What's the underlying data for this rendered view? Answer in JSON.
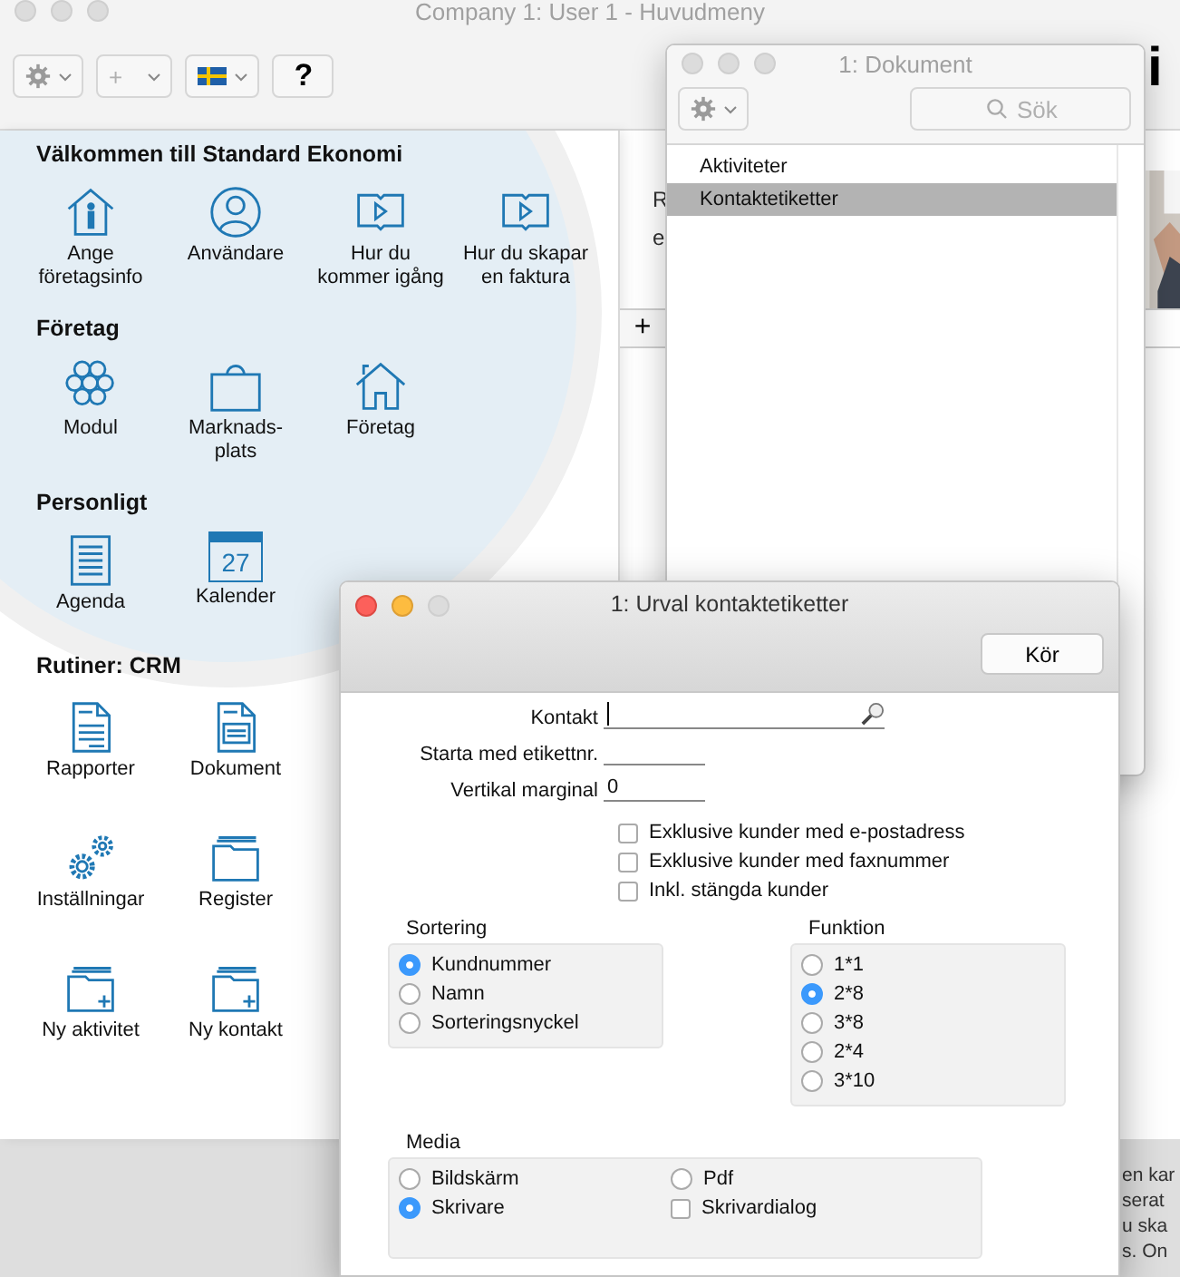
{
  "main_window": {
    "title": "Company 1: User 1 - Huvudmeny",
    "toolbar": {
      "add_label": "+",
      "help_label": "?"
    },
    "logo_fragment": "i",
    "sections": [
      {
        "title": "Välkommen till Standard Ekonomi",
        "items": [
          {
            "label": "Ange\nföretagsinfo",
            "kind": "info"
          },
          {
            "label": "Användare",
            "kind": "user"
          },
          {
            "label": "Hur du\nkommer igång",
            "kind": "guide"
          },
          {
            "label": "Hur du skapar\nen faktura",
            "kind": "guide"
          }
        ]
      },
      {
        "title": "Företag",
        "items": [
          {
            "label": "Modul",
            "kind": "modules"
          },
          {
            "label": "Marknads-\nplats",
            "kind": "bag"
          },
          {
            "label": "Företag",
            "kind": "house"
          }
        ]
      },
      {
        "title": "Personligt",
        "items": [
          {
            "label": "Agenda",
            "kind": "agenda"
          },
          {
            "label": "Kalender",
            "kind": "calendar",
            "day": "27"
          }
        ]
      },
      {
        "title": "Rutiner: CRM",
        "items": [
          {
            "label": "Rapporter",
            "kind": "report"
          },
          {
            "label": "Dokument",
            "kind": "document"
          },
          {
            "label": "Inställningar",
            "kind": "gears"
          },
          {
            "label": "Register",
            "kind": "folder"
          },
          {
            "label": "Ny aktivitet",
            "kind": "folder-add"
          },
          {
            "label": "Ny kontakt",
            "kind": "folder-add"
          }
        ]
      }
    ],
    "right_pane": {
      "text_fragments": [
        "R",
        "e"
      ],
      "add_label": "+"
    },
    "background_text": [
      "en kar",
      "serat",
      "u ska",
      "s. On"
    ]
  },
  "document_window": {
    "title": "1: Dokument",
    "search": {
      "placeholder": "Sök"
    },
    "items": [
      {
        "label": "Aktiviteter",
        "selected": false
      },
      {
        "label": "Kontaktetiketter",
        "selected": true
      }
    ]
  },
  "dialog": {
    "title": "1: Urval kontaktetiketter",
    "run_button": "Kör",
    "fields": [
      {
        "label": "Kontakt",
        "kind": "lookup"
      },
      {
        "label": "Starta med etikettnr.",
        "kind": "short"
      },
      {
        "label": "Vertikal marginal",
        "value": "0",
        "kind": "short"
      }
    ],
    "checkboxes": [
      {
        "label": "Exklusive kunder med e-postadress",
        "checked": false
      },
      {
        "label": "Exklusive kunder med faxnummer",
        "checked": false
      },
      {
        "label": "Inkl. stängda kunder",
        "checked": false
      }
    ],
    "sorting": {
      "title": "Sortering",
      "options": [
        {
          "label": "Kundnummer",
          "selected": true
        },
        {
          "label": "Namn",
          "selected": false
        },
        {
          "label": "Sorteringsnyckel",
          "selected": false
        }
      ]
    },
    "function": {
      "title": "Funktion",
      "options": [
        {
          "label": "1*1",
          "selected": false
        },
        {
          "label": "2*8",
          "selected": true
        },
        {
          "label": "3*8",
          "selected": false
        },
        {
          "label": "2*4",
          "selected": false
        },
        {
          "label": "3*10",
          "selected": false
        }
      ]
    },
    "media": {
      "title": "Media",
      "options": [
        {
          "label": "Bildskärm",
          "kind": "radio",
          "selected": false
        },
        {
          "label": "Pdf",
          "kind": "radio",
          "selected": false
        },
        {
          "label": "Skrivare",
          "kind": "radio",
          "selected": true
        },
        {
          "label": "Skrivardialog",
          "kind": "checkbox",
          "checked": false
        }
      ]
    }
  }
}
